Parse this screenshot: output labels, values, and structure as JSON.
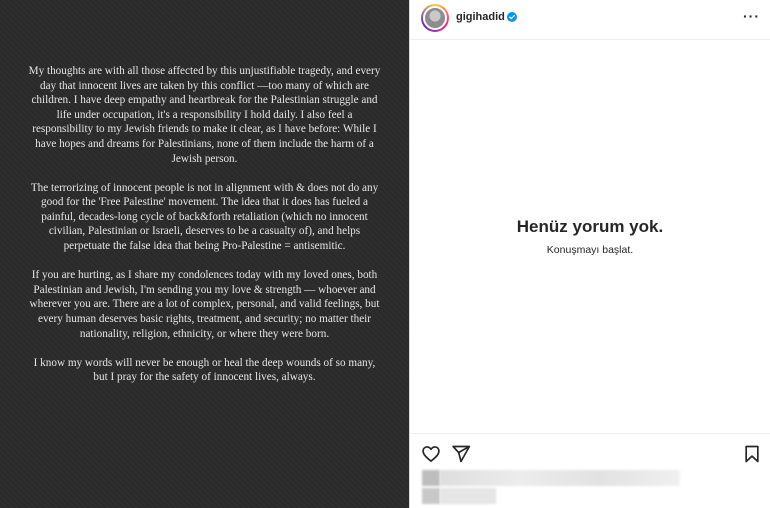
{
  "post": {
    "paragraphs": [
      "My thoughts are with all those affected by this unjustifiable tragedy, and every day that innocent lives are taken by this conflict —too many of which are children. I have deep empathy and heartbreak for the Palestinian struggle and life under occupation, it's a responsibility I hold daily. I also feel a responsibility to my Jewish friends to make it clear, as I have before: While I have hopes and dreams for Palestinians, none of them include the harm of a Jewish person.",
      "The terrorizing of innocent people is not in alignment with & does not do any good for the 'Free Palestine' movement. The idea that it does has fueled a painful, decades-long cycle of back&forth retaliation (which no innocent civilian, Palestinian or Israeli, deserves to be a casualty of), and helps perpetuate the false idea that being Pro-Palestine = antisemitic.",
      "If you are hurting, as I share my condolences today with my loved ones, both Palestinian and Jewish, I'm sending you my love & strength — whoever and wherever you are. There are a lot of complex, personal, and valid feelings, but every human deserves basic rights, treatment, and security; no matter their nationality, religion, ethnicity, or where they were born.",
      "I know my words will never be enough or heal the deep wounds of so many, but I pray for the safety of innocent lives, always."
    ]
  },
  "header": {
    "username": "gigihadid",
    "more_label": "···",
    "avatar_icon": "profile-avatar",
    "verified_icon": "verified-badge-icon",
    "verified_color": "#0095f6"
  },
  "comments": {
    "empty_title": "Henüz yorum yok.",
    "empty_subtitle": "Konuşmayı başlat."
  },
  "actions": {
    "icons": [
      "heart-icon",
      "send-icon",
      "bookmark-icon"
    ]
  }
}
